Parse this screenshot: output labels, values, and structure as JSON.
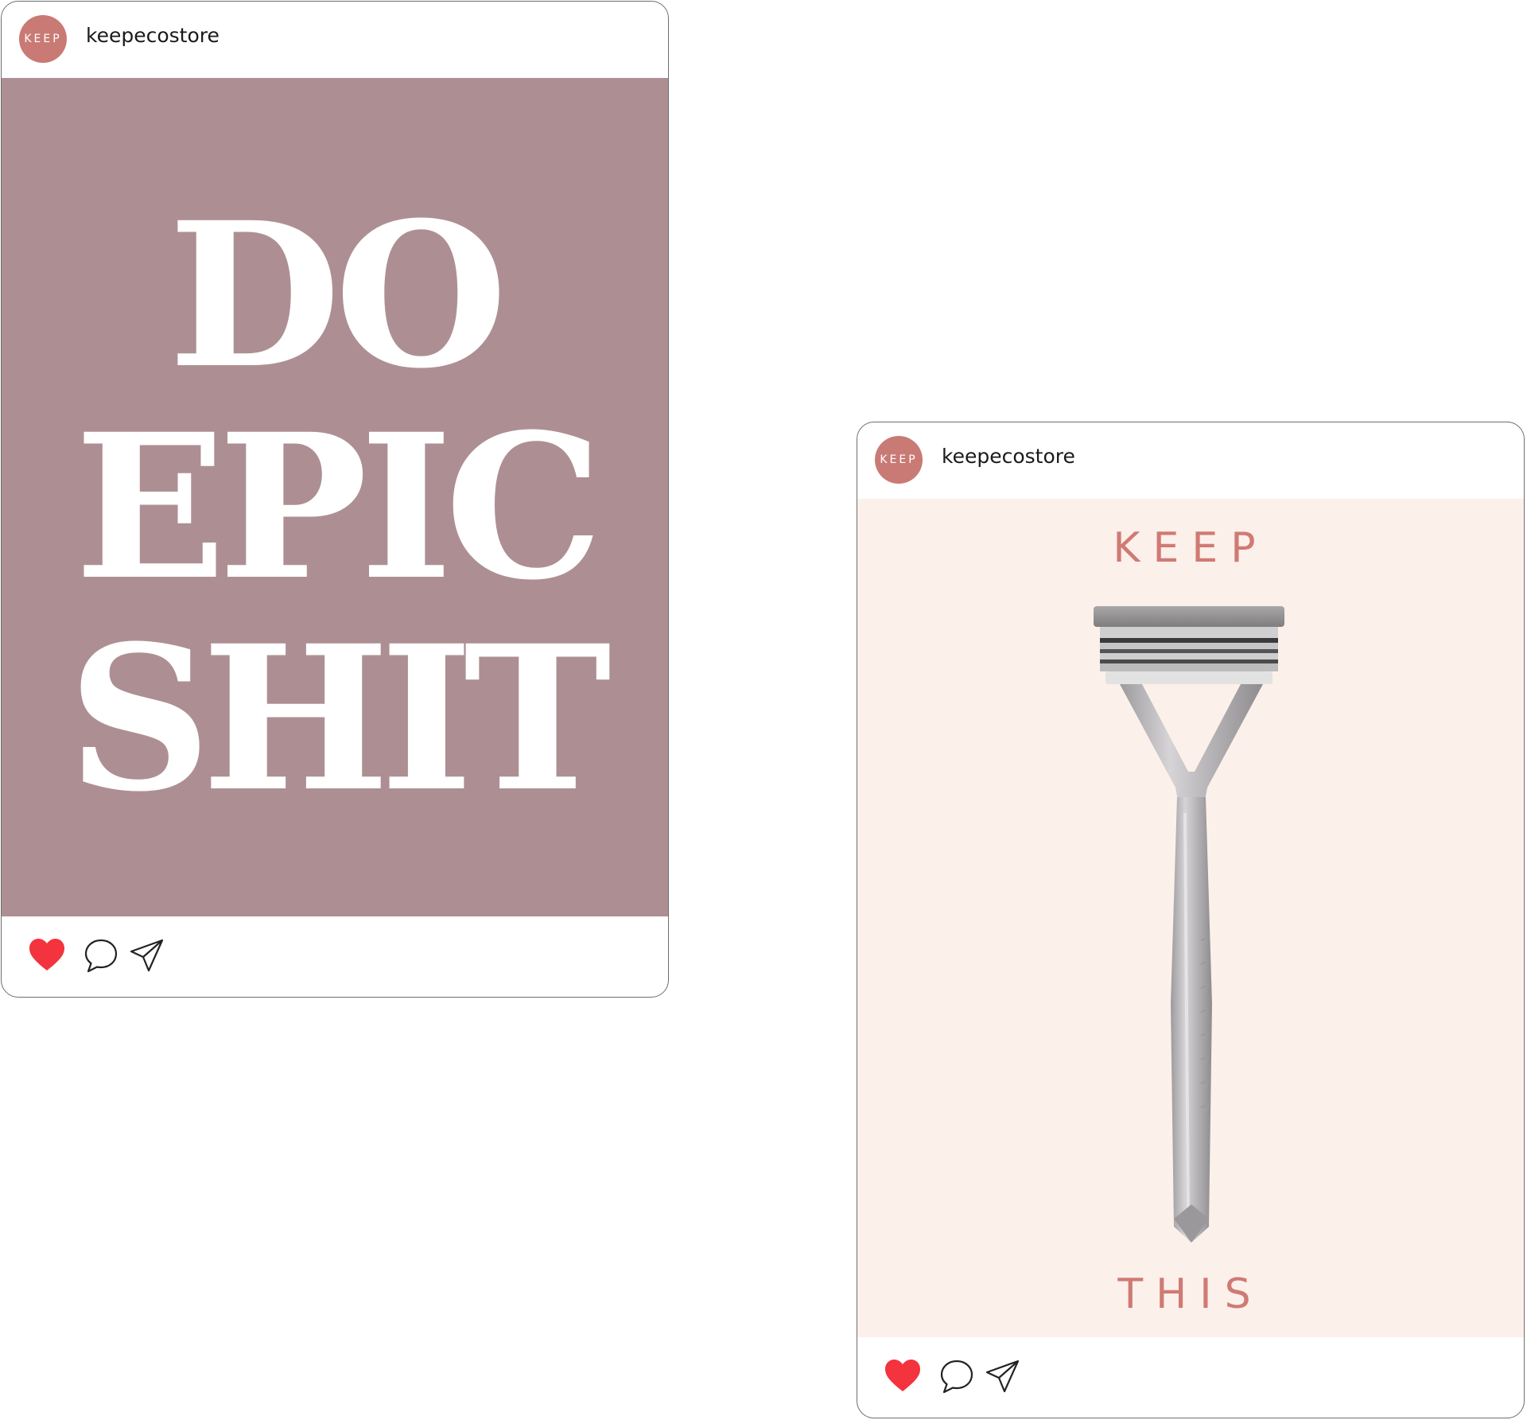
{
  "posts": [
    {
      "username": "keepecostore",
      "avatar_text": "KEEP",
      "avatar_color": "#c97a74",
      "background_color": "#ad8f93",
      "poster_lines": [
        "DO",
        "EPIC",
        "SHIT"
      ],
      "actions": {
        "liked": true,
        "like_icon": "heart-icon",
        "comment_icon": "comment-icon",
        "share_icon": "send-icon"
      }
    },
    {
      "username": "keepecostore",
      "avatar_text": "KEEP",
      "avatar_color": "#c97a74",
      "background_color": "#fcf0ea",
      "text_color": "#d07a74",
      "top_word": "KEEP",
      "bottom_word": "THIS",
      "product_image": "razor",
      "actions": {
        "liked": true,
        "like_icon": "heart-icon",
        "comment_icon": "comment-icon",
        "share_icon": "send-icon"
      }
    }
  ],
  "colors": {
    "like_red": "#f3333d",
    "border": "#6e6e6e"
  }
}
